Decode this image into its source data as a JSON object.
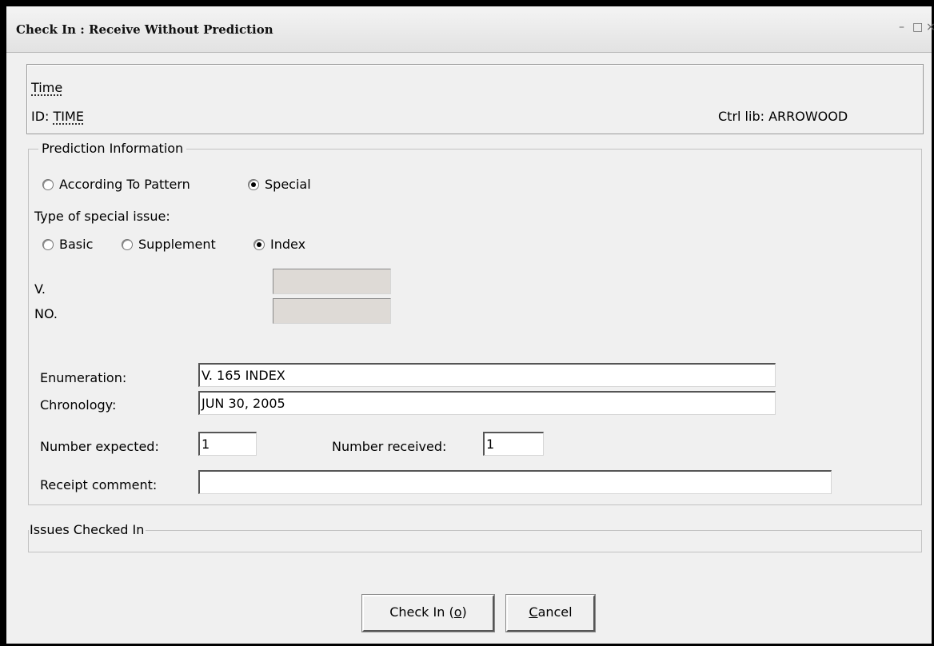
{
  "window": {
    "title": "Check In : Receive Without Prediction",
    "minimize_glyph": "–",
    "maximize_glyph": "□",
    "close_glyph": "×"
  },
  "title_info": {
    "title": "Time",
    "id_label": "ID: ",
    "id_value": "TIME",
    "ctrl_lib": "Ctrl lib: ARROWOOD"
  },
  "prediction": {
    "legend": "Prediction Information",
    "mode_options": [
      {
        "label": "According To Pattern",
        "selected": false
      },
      {
        "label": "Special",
        "selected": true
      }
    ],
    "special_type_label": "Type of special issue:",
    "special_types": [
      {
        "label": "Basic",
        "selected": false
      },
      {
        "label": "Supplement",
        "selected": false
      },
      {
        "label": "Index",
        "selected": true
      }
    ],
    "v_label": "V.",
    "v_value": "",
    "no_label": "NO.",
    "no_value": "",
    "enumeration_label": "Enumeration:",
    "enumeration_value": "V. 165 INDEX",
    "chronology_label": "Chronology:",
    "chronology_value": "JUN 30, 2005",
    "number_expected_label": "Number expected:",
    "number_expected_value": "1",
    "number_received_label": "Number received:",
    "number_received_value": "1",
    "receipt_comment_label": "Receipt comment:",
    "receipt_comment_value": ""
  },
  "issues": {
    "legend": "Issues Checked In"
  },
  "buttons": {
    "checkin_prefix": "Check In (",
    "checkin_key": "o",
    "checkin_suffix": ")",
    "cancel_key": "C",
    "cancel_rest": "ancel"
  }
}
